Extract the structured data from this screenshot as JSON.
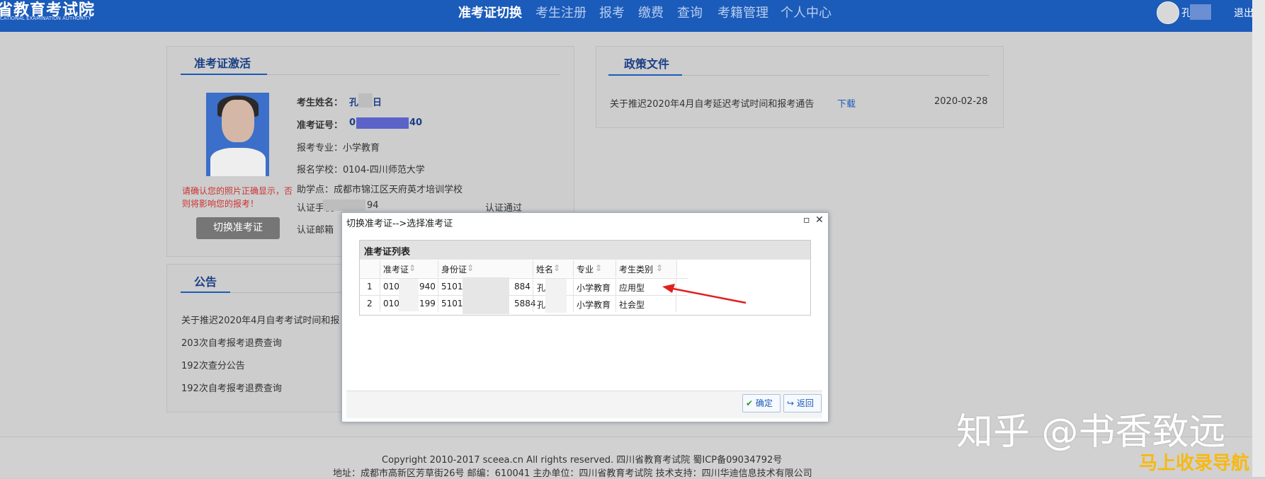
{
  "header": {
    "logo_title": "省教育考试院",
    "logo_sub": "CATIONAL EXAMINATION AUTHORITY",
    "nav": [
      "准考证切换",
      "考生注册",
      "报考",
      "缴费",
      "查询",
      "考籍管理",
      "个人中心"
    ],
    "user": "孔",
    "logout": "退出"
  },
  "activation": {
    "tab": "准考证激活",
    "name_label": "考生姓名：",
    "name_value": "孔",
    "name_value2": "日",
    "ticket_label": "准考证号：",
    "ticket_prefix": "0",
    "ticket_suffix": "40",
    "major": "报考专业：小学教育",
    "school": "报名学校：0104-四川师范大学",
    "assist": "助学点：成都市锦江区天府英才培训学校",
    "phone_label": "认证手机：15",
    "phone_suffix": "94",
    "phone_status": "认证通过",
    "email_label": "认证邮箱",
    "warn1": "请确认您的照片正确显示，否",
    "warn2": "则将影响您的报考！",
    "switch_button": "切换准考证"
  },
  "notice": {
    "tab": "公告",
    "items": [
      "关于推迟2020年4月自考考试时间和报",
      "203次自考报考退费查询",
      "192次查分公告",
      "192次自考报考退费查询"
    ]
  },
  "policy": {
    "tab": "政策文件",
    "title": "关于推迟2020年4月自考延迟考试时间和报考通告",
    "download": "下载",
    "date": "2020-02-28"
  },
  "modal": {
    "title": "切换准考证-->选择准考证",
    "grid_title": "准考证列表",
    "columns": [
      "准考证",
      "身份证",
      "姓名",
      "专业",
      "考生类别"
    ],
    "rows": [
      {
        "index": "1",
        "ticket_a": "010",
        "ticket_b": "940",
        "id_a": "51012",
        "id_b": "884",
        "name": "孔",
        "major": "小学教育",
        "type": "应用型"
      },
      {
        "index": "2",
        "ticket_a": "0104",
        "ticket_b": "199",
        "id_a": "510121",
        "id_b": "5884",
        "name": "孔",
        "major": "小学教育",
        "type": "社会型"
      }
    ],
    "ok": "确定",
    "back": "返回"
  },
  "footer": {
    "line1": "Copyright 2010-2017 sceea.cn All rights reserved. 四川省教育考试院 蜀ICP备09034792号",
    "line2": "地址：成都市高新区芳草街26号 邮编：610041 主办单位：四川省教育考试院 技术支持：四川华迪信息技术有限公司"
  },
  "watermark": {
    "main": "知乎 @书香致远",
    "sub": "马上收录导航"
  }
}
